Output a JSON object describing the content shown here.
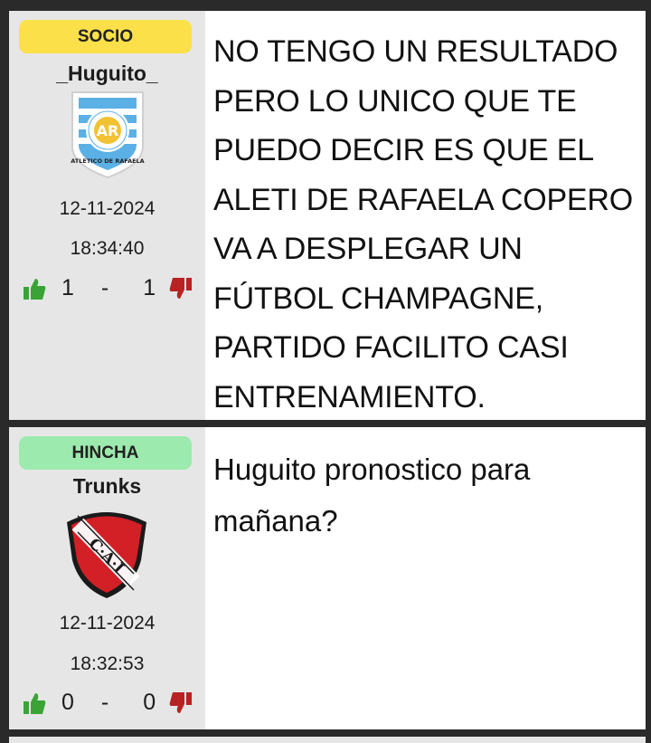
{
  "posts": [
    {
      "role_badge": "SOCIO",
      "username": "_Huguito_",
      "crest_icon": "atletico-de-rafaela-crest",
      "crest_text": "AR",
      "crest_ring_text": "ATLETICO DE RAFAELA",
      "date": "12-11-2024",
      "time": "18:34:40",
      "likes": "1",
      "separator": "-",
      "dislikes": "1",
      "message": "NO TENGO UN RESULTADO PERO LO UNICO QUE TE PUEDO DECIR ES QUE EL ALETI DE RAFAELA COPERO VA A DESPLEGAR UN FÚTBOL CHAMPAGNE, PARTIDO FACILITO CASI ENTRENAMIENTO."
    },
    {
      "role_badge": "HINCHA",
      "username": "Trunks",
      "crest_icon": "independiente-crest",
      "crest_text": "C·A·I",
      "date": "12-11-2024",
      "time": "18:32:53",
      "likes": "0",
      "separator": "-",
      "dislikes": "0",
      "message": "Huguito pronostico para mañana?"
    }
  ],
  "colors": {
    "socio_badge": "#fbe04a",
    "hincha_badge": "#9deaae",
    "like_green": "#3aa336",
    "dislike_red": "#b82222",
    "author_panel": "#e6e6e6",
    "separator_bar": "#2a2a2a"
  }
}
